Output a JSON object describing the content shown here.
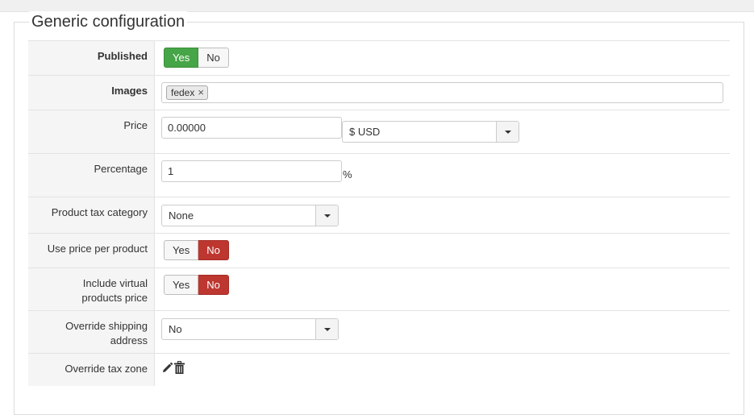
{
  "legend": "Generic configuration",
  "rows": {
    "published": {
      "label": "Published",
      "yes": "Yes",
      "no": "No",
      "selected": "Yes"
    },
    "images": {
      "label": "Images",
      "tags": [
        "fedex"
      ],
      "remove_glyph": "×"
    },
    "price": {
      "label": "Price",
      "value": "0.00000",
      "currency": "$ USD"
    },
    "percentage": {
      "label": "Percentage",
      "value": "1",
      "suffix": "%"
    },
    "tax_category": {
      "label": "Product tax category",
      "value": "None"
    },
    "price_per_product": {
      "label": "Use price per product",
      "yes": "Yes",
      "no": "No",
      "selected": "No"
    },
    "include_virtual": {
      "label_line1": "Include virtual",
      "label_line2": "products price",
      "yes": "Yes",
      "no": "No",
      "selected": "No"
    },
    "override_shipping": {
      "label_line1": "Override shipping",
      "label_line2": "address",
      "value": "No"
    },
    "override_tax_zone": {
      "label": "Override tax zone",
      "icons": [
        "pencil-icon",
        "trash-icon"
      ]
    }
  },
  "colors": {
    "yes_active": "#46a546",
    "no_active": "#bd362f"
  }
}
